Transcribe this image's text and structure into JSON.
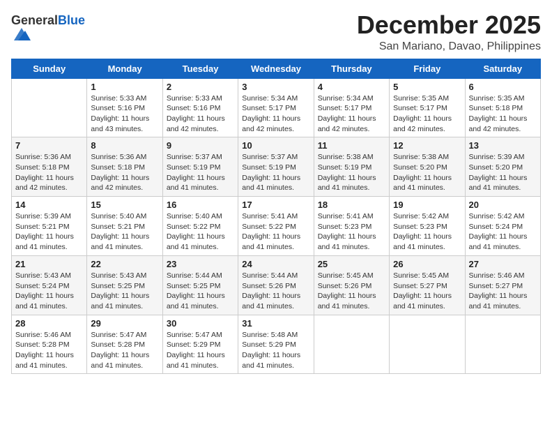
{
  "header": {
    "logo_general": "General",
    "logo_blue": "Blue",
    "month_title": "December 2025",
    "location": "San Mariano, Davao, Philippines"
  },
  "weekdays": [
    "Sunday",
    "Monday",
    "Tuesday",
    "Wednesday",
    "Thursday",
    "Friday",
    "Saturday"
  ],
  "weeks": [
    [
      {
        "day": "",
        "info": ""
      },
      {
        "day": "1",
        "info": "Sunrise: 5:33 AM\nSunset: 5:16 PM\nDaylight: 11 hours\nand 43 minutes."
      },
      {
        "day": "2",
        "info": "Sunrise: 5:33 AM\nSunset: 5:16 PM\nDaylight: 11 hours\nand 42 minutes."
      },
      {
        "day": "3",
        "info": "Sunrise: 5:34 AM\nSunset: 5:17 PM\nDaylight: 11 hours\nand 42 minutes."
      },
      {
        "day": "4",
        "info": "Sunrise: 5:34 AM\nSunset: 5:17 PM\nDaylight: 11 hours\nand 42 minutes."
      },
      {
        "day": "5",
        "info": "Sunrise: 5:35 AM\nSunset: 5:17 PM\nDaylight: 11 hours\nand 42 minutes."
      },
      {
        "day": "6",
        "info": "Sunrise: 5:35 AM\nSunset: 5:18 PM\nDaylight: 11 hours\nand 42 minutes."
      }
    ],
    [
      {
        "day": "7",
        "info": "Sunrise: 5:36 AM\nSunset: 5:18 PM\nDaylight: 11 hours\nand 42 minutes."
      },
      {
        "day": "8",
        "info": "Sunrise: 5:36 AM\nSunset: 5:18 PM\nDaylight: 11 hours\nand 42 minutes."
      },
      {
        "day": "9",
        "info": "Sunrise: 5:37 AM\nSunset: 5:19 PM\nDaylight: 11 hours\nand 41 minutes."
      },
      {
        "day": "10",
        "info": "Sunrise: 5:37 AM\nSunset: 5:19 PM\nDaylight: 11 hours\nand 41 minutes."
      },
      {
        "day": "11",
        "info": "Sunrise: 5:38 AM\nSunset: 5:19 PM\nDaylight: 11 hours\nand 41 minutes."
      },
      {
        "day": "12",
        "info": "Sunrise: 5:38 AM\nSunset: 5:20 PM\nDaylight: 11 hours\nand 41 minutes."
      },
      {
        "day": "13",
        "info": "Sunrise: 5:39 AM\nSunset: 5:20 PM\nDaylight: 11 hours\nand 41 minutes."
      }
    ],
    [
      {
        "day": "14",
        "info": "Sunrise: 5:39 AM\nSunset: 5:21 PM\nDaylight: 11 hours\nand 41 minutes."
      },
      {
        "day": "15",
        "info": "Sunrise: 5:40 AM\nSunset: 5:21 PM\nDaylight: 11 hours\nand 41 minutes."
      },
      {
        "day": "16",
        "info": "Sunrise: 5:40 AM\nSunset: 5:22 PM\nDaylight: 11 hours\nand 41 minutes."
      },
      {
        "day": "17",
        "info": "Sunrise: 5:41 AM\nSunset: 5:22 PM\nDaylight: 11 hours\nand 41 minutes."
      },
      {
        "day": "18",
        "info": "Sunrise: 5:41 AM\nSunset: 5:23 PM\nDaylight: 11 hours\nand 41 minutes."
      },
      {
        "day": "19",
        "info": "Sunrise: 5:42 AM\nSunset: 5:23 PM\nDaylight: 11 hours\nand 41 minutes."
      },
      {
        "day": "20",
        "info": "Sunrise: 5:42 AM\nSunset: 5:24 PM\nDaylight: 11 hours\nand 41 minutes."
      }
    ],
    [
      {
        "day": "21",
        "info": "Sunrise: 5:43 AM\nSunset: 5:24 PM\nDaylight: 11 hours\nand 41 minutes."
      },
      {
        "day": "22",
        "info": "Sunrise: 5:43 AM\nSunset: 5:25 PM\nDaylight: 11 hours\nand 41 minutes."
      },
      {
        "day": "23",
        "info": "Sunrise: 5:44 AM\nSunset: 5:25 PM\nDaylight: 11 hours\nand 41 minutes."
      },
      {
        "day": "24",
        "info": "Sunrise: 5:44 AM\nSunset: 5:26 PM\nDaylight: 11 hours\nand 41 minutes."
      },
      {
        "day": "25",
        "info": "Sunrise: 5:45 AM\nSunset: 5:26 PM\nDaylight: 11 hours\nand 41 minutes."
      },
      {
        "day": "26",
        "info": "Sunrise: 5:45 AM\nSunset: 5:27 PM\nDaylight: 11 hours\nand 41 minutes."
      },
      {
        "day": "27",
        "info": "Sunrise: 5:46 AM\nSunset: 5:27 PM\nDaylight: 11 hours\nand 41 minutes."
      }
    ],
    [
      {
        "day": "28",
        "info": "Sunrise: 5:46 AM\nSunset: 5:28 PM\nDaylight: 11 hours\nand 41 minutes."
      },
      {
        "day": "29",
        "info": "Sunrise: 5:47 AM\nSunset: 5:28 PM\nDaylight: 11 hours\nand 41 minutes."
      },
      {
        "day": "30",
        "info": "Sunrise: 5:47 AM\nSunset: 5:29 PM\nDaylight: 11 hours\nand 41 minutes."
      },
      {
        "day": "31",
        "info": "Sunrise: 5:48 AM\nSunset: 5:29 PM\nDaylight: 11 hours\nand 41 minutes."
      },
      {
        "day": "",
        "info": ""
      },
      {
        "day": "",
        "info": ""
      },
      {
        "day": "",
        "info": ""
      }
    ]
  ]
}
